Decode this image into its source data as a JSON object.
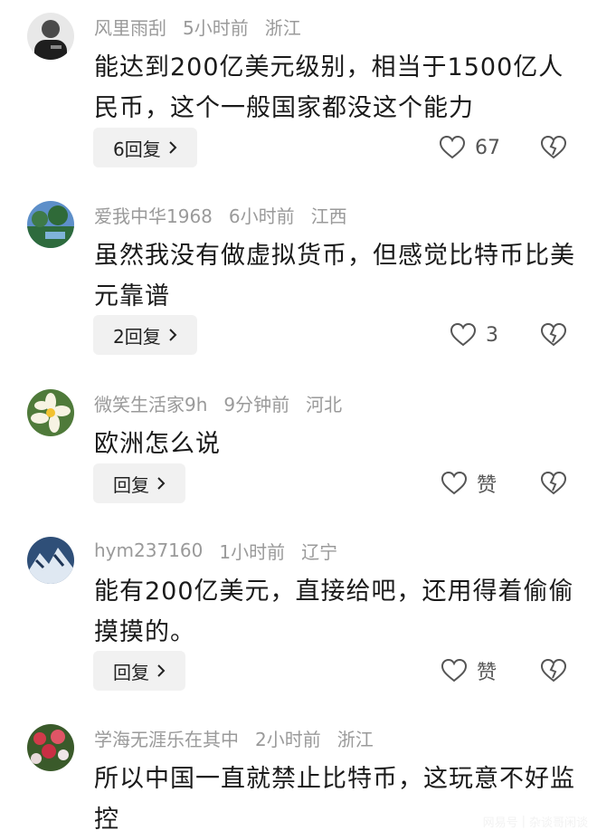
{
  "comments": [
    {
      "user": "风里雨刮",
      "time": "5小时前",
      "location": "浙江",
      "text": "能达到200亿美元级别，相当于1500亿人民币，这个一般国家都没这个能力",
      "reply_label": "6回复",
      "likes": "67"
    },
    {
      "user": "爱我中华1968",
      "time": "6小时前",
      "location": "江西",
      "text": "虽然我没有做虚拟货币，但感觉比特币比美元靠谱",
      "reply_label": "2回复",
      "likes": "3"
    },
    {
      "user": "微笑生活家9h",
      "time": "9分钟前",
      "location": "河北",
      "text": "欧洲怎么说",
      "reply_label": "回复",
      "likes": "赞"
    },
    {
      "user": "hym237160",
      "time": "1小时前",
      "location": "辽宁",
      "text": "能有200亿美元，直接给吧，还用得着偷偷摸摸的。",
      "reply_label": "回复",
      "likes": "赞"
    },
    {
      "user": "学海无涯乐在其中",
      "time": "2小时前",
      "location": "浙江",
      "text": "所以中国一直就禁止比特币，这玩意不好监控"
    }
  ],
  "watermark": {
    "brand": "网易号",
    "account": "杂谈哥闲谈"
  },
  "icons": {
    "like": "heart-outline-icon",
    "dislike": "broken-heart-icon",
    "reply": "chevron-right-icon"
  },
  "colors": {
    "meta_text": "#9a9a9a",
    "body_text": "#1a1a1a",
    "reply_bg": "#f1f1f1"
  }
}
